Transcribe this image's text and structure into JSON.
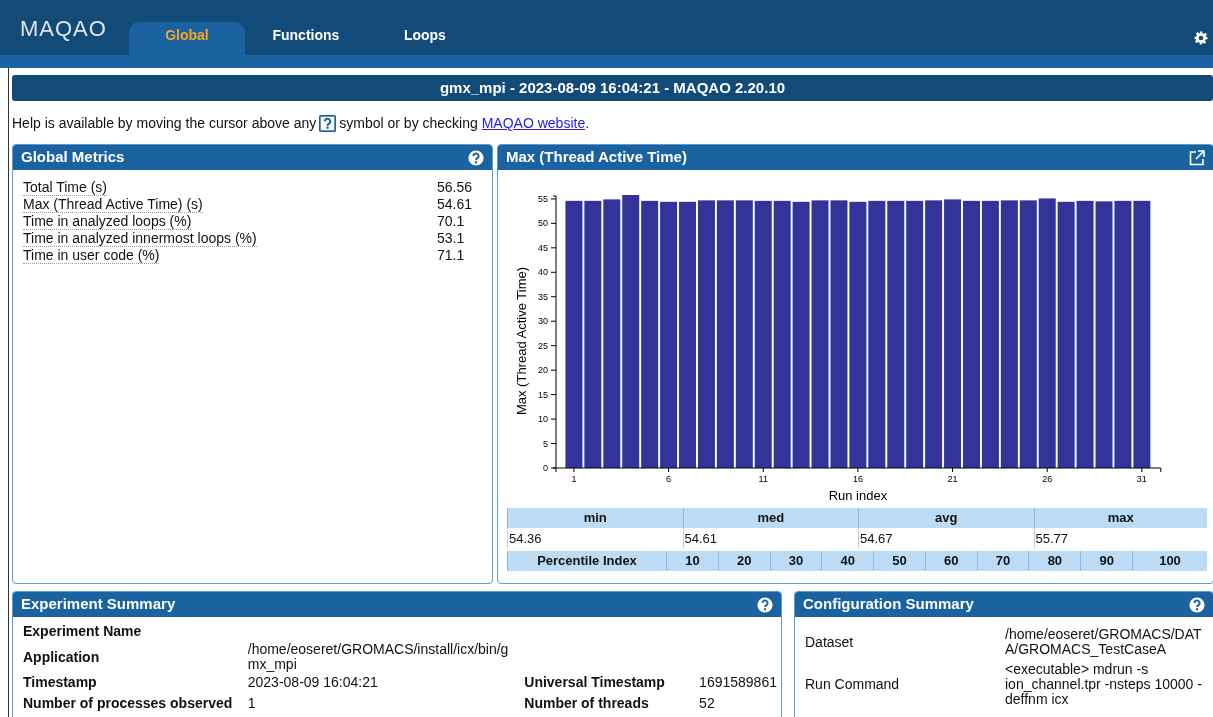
{
  "nav": {
    "logo": "MAQAO",
    "tabs": [
      {
        "label": "Global",
        "selected": true
      },
      {
        "label": "Functions",
        "selected": false
      },
      {
        "label": "Loops",
        "selected": false
      }
    ]
  },
  "title": "gmx_mpi - 2023-08-09 16:04:21 - MAQAO 2.20.10",
  "help": {
    "before": "Help is available by moving the cursor above any",
    "after": "symbol or by checking",
    "link": "MAQAO website",
    "end": "."
  },
  "global_metrics": {
    "title": "Global Metrics",
    "rows": [
      {
        "label": "Total Time (s)",
        "value": "56.56"
      },
      {
        "label": "Max (Thread Active Time) (s)",
        "value": "54.61"
      },
      {
        "label": "Time in analyzed loops (%)",
        "value": "70.1"
      },
      {
        "label": "Time in analyzed innermost loops (%)",
        "value": "53.1"
      },
      {
        "label": "Time in user code (%)",
        "value": "71.1"
      }
    ]
  },
  "chart_panel": {
    "title": "Max (Thread Active Time)",
    "chart_data": {
      "type": "bar",
      "xlabel": "Run index",
      "ylabel": "Max (Thread Active Time)",
      "x": [
        1,
        2,
        3,
        4,
        5,
        6,
        7,
        8,
        9,
        10,
        11,
        12,
        13,
        14,
        15,
        16,
        17,
        18,
        19,
        20,
        21,
        22,
        23,
        24,
        25,
        26,
        27,
        28,
        29,
        30,
        31
      ],
      "series": [
        {
          "color": "#333399",
          "values": [
            54.6,
            54.6,
            54.9,
            55.8,
            54.6,
            54.4,
            54.4,
            54.7,
            54.7,
            54.7,
            54.6,
            54.6,
            54.4,
            54.7,
            54.7,
            54.4,
            54.6,
            54.6,
            54.6,
            54.7,
            54.9,
            54.6,
            54.6,
            54.7,
            54.7,
            55.1,
            54.4,
            54.6,
            54.5,
            54.6,
            54.6
          ]
        }
      ],
      "xlim": [
        0,
        32
      ],
      "ylim": [
        0,
        56
      ],
      "yticks": [
        0,
        5,
        10,
        15,
        20,
        25,
        30,
        35,
        40,
        45,
        50,
        55
      ],
      "xticks": [
        1,
        6,
        11,
        16,
        21,
        26,
        31
      ]
    },
    "stats": {
      "headers": [
        "min",
        "med",
        "avg",
        "max"
      ],
      "values": [
        "54.36",
        "54.61",
        "54.67",
        "55.77"
      ]
    },
    "percentiles": {
      "label": "Percentile Index",
      "headers": [
        "10",
        "20",
        "30",
        "40",
        "50",
        "60",
        "70",
        "80",
        "90",
        "100"
      ]
    }
  },
  "experiment_summary": {
    "title": "Experiment Summary",
    "rows": [
      {
        "pairs": [
          {
            "label": "Experiment Name"
          }
        ]
      },
      {
        "pairs": [
          {
            "label": "Application",
            "value": "/home/eoseret/GROMACS/install/icx/bin/gmx_mpi"
          }
        ]
      },
      {
        "pairs": [
          {
            "label": "Timestamp",
            "value": "2023-08-09 16:04:21"
          },
          {
            "label": "Universal Timestamp",
            "value": "1691589861"
          }
        ]
      },
      {
        "pairs": [
          {
            "label": "Number of processes observed",
            "value": "1"
          },
          {
            "label": "Number of threads",
            "value": "52"
          }
        ]
      }
    ]
  },
  "configuration_summary": {
    "title": "Configuration Summary",
    "rows": [
      {
        "label": "Dataset",
        "value": "/home/eoseret/GROMACS/DATA/GROMACS_TestCaseA"
      },
      {
        "label": "Run Command",
        "value": "<executable> mdrun -s ion_channel.tpr -nsteps 10000 -deffnm icx"
      }
    ]
  }
}
